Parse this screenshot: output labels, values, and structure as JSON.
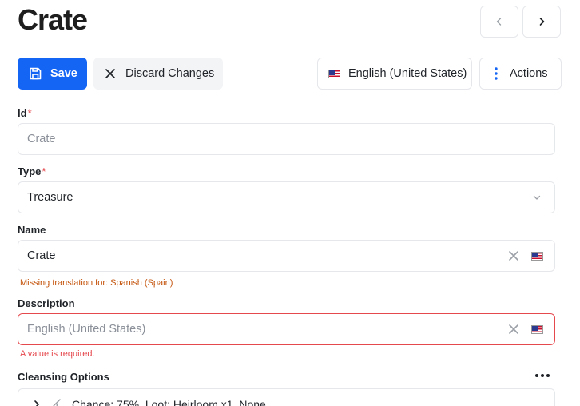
{
  "header": {
    "title": "Crate"
  },
  "toolbar": {
    "save_label": "Save",
    "discard_label": "Discard Changes",
    "language_label": "English (United States)",
    "actions_label": "Actions"
  },
  "form": {
    "id": {
      "label": "Id",
      "required_mark": "*",
      "value": "Crate"
    },
    "type": {
      "label": "Type",
      "required_mark": "*",
      "value": "Treasure"
    },
    "name": {
      "label": "Name",
      "value": "Crate",
      "warning": "Missing translation for: Spanish (Spain)"
    },
    "description": {
      "label": "Description",
      "placeholder": "English (United States)",
      "error": "A value is required."
    },
    "cleansing": {
      "label": "Cleansing Options",
      "items": [
        {
          "text": "Chance: 75%, Loot: Heirloom x1, None"
        }
      ]
    }
  },
  "colors": {
    "accent": "#1565f5",
    "error": "#e5484d",
    "warning": "#c4530b"
  },
  "icons": [
    "chevron-left-icon",
    "chevron-right-icon",
    "save-icon",
    "close-icon",
    "us-flag-icon",
    "more-vertical-icon",
    "chevron-down-icon",
    "clear-icon",
    "more-horizontal-icon",
    "chevron-right-icon",
    "broom-icon"
  ]
}
